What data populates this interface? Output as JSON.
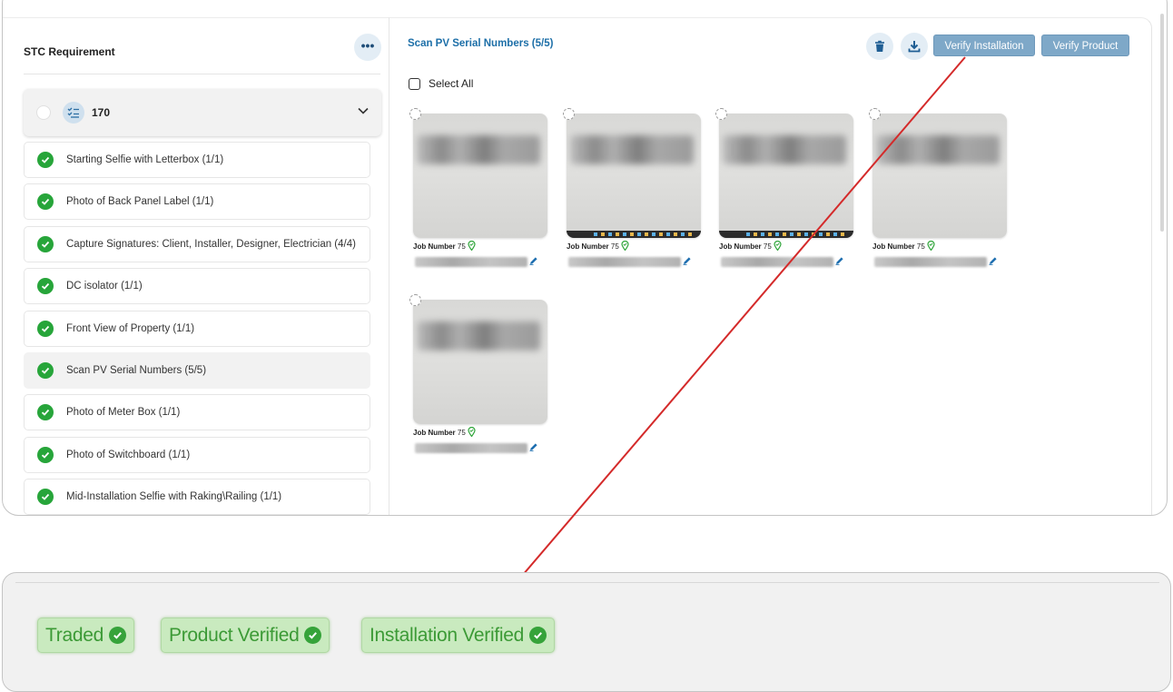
{
  "requirements": {
    "title": "STC Requirement",
    "more_label": "•••",
    "group_number": "170",
    "items": [
      {
        "label": "Starting Selfie with Letterbox (1/1)"
      },
      {
        "label": "Photo of Back Panel Label (1/1)"
      },
      {
        "label": "Capture Signatures: Client, Installer, Designer, Electrician (4/4)"
      },
      {
        "label": "DC isolator (1/1)"
      },
      {
        "label": "Front View of Property (1/1)"
      },
      {
        "label": "Scan PV Serial Numbers (5/5)"
      },
      {
        "label": "Photo of Meter Box (1/1)"
      },
      {
        "label": "Photo of Switchboard (1/1)"
      },
      {
        "label": "Mid-Installation Selfie with Raking\\Railing (1/1)"
      }
    ],
    "active_index": 5
  },
  "detail": {
    "title": "Scan PV Serial Numbers (5/5)",
    "delete_icon": "trash-icon",
    "download_icon": "download-icon",
    "verify_installation_label": "Verify Installation",
    "verify_product_label": "Verify Product",
    "select_all_label": "Select All",
    "photos": [
      {
        "job_label": "Job Number",
        "job_number": "75",
        "has_taskbar": false
      },
      {
        "job_label": "Job Number",
        "job_number": "75",
        "has_taskbar": true
      },
      {
        "job_label": "Job Number",
        "job_number": "75",
        "has_taskbar": true
      },
      {
        "job_label": "Job Number",
        "job_number": "75",
        "has_taskbar": false
      },
      {
        "job_label": "Job Number",
        "job_number": "75",
        "has_taskbar": false
      }
    ]
  },
  "status_badges": [
    {
      "label": "Traded"
    },
    {
      "label": "Product Verified"
    },
    {
      "label": "Installation Verified"
    }
  ],
  "colors": {
    "accent_blue": "#1d6fa8",
    "button_blue": "#7ea8c8",
    "success_green": "#27a53a",
    "badge_bg": "#c9eabf",
    "arrow_red": "#d42a2a"
  }
}
